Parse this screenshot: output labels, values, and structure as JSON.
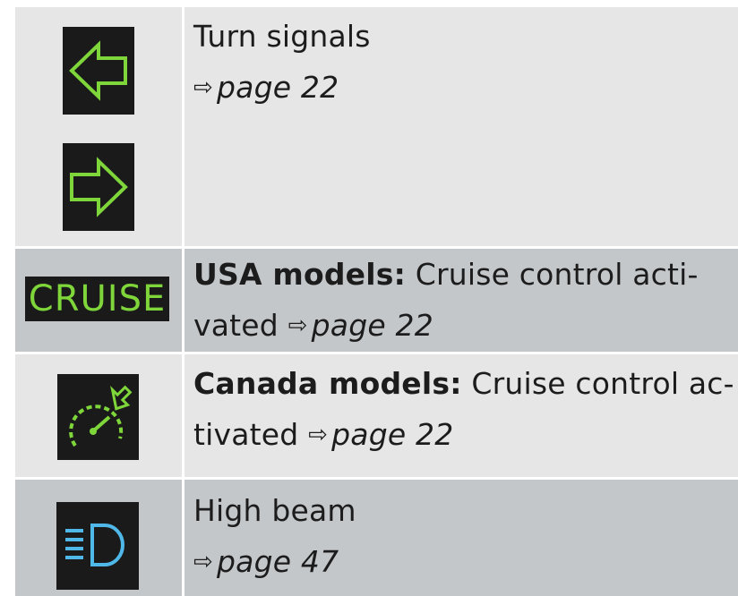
{
  "rows": [
    {
      "icons": [
        "turn-signal-left-icon",
        "turn-signal-right-icon"
      ],
      "title": "Turn signals",
      "ref_arrow": "⇨",
      "ref_page": "page 22"
    },
    {
      "icon_text": "CRUISE",
      "bold": "USA models:",
      "text_line1": " Cruise control acti-",
      "text_line2": "vated ",
      "ref_arrow": "⇨",
      "ref_page": "page 22"
    },
    {
      "icons": [
        "cruise-control-speedometer-icon"
      ],
      "bold": "Canada models:",
      "text_line1": " Cruise control ac-",
      "text_line2": "tivated ",
      "ref_arrow": "⇨",
      "ref_page": "page 22"
    },
    {
      "icons": [
        "high-beam-icon"
      ],
      "title": "High beam",
      "ref_arrow": "⇨",
      "ref_page": "page 47"
    }
  ],
  "colors": {
    "green_indicator": "#7fd63a",
    "blue_indicator": "#4fb8e8",
    "icon_background": "#1a1a1a",
    "row_light": "#e6e6e6",
    "row_dark": "#c3c7ca"
  }
}
